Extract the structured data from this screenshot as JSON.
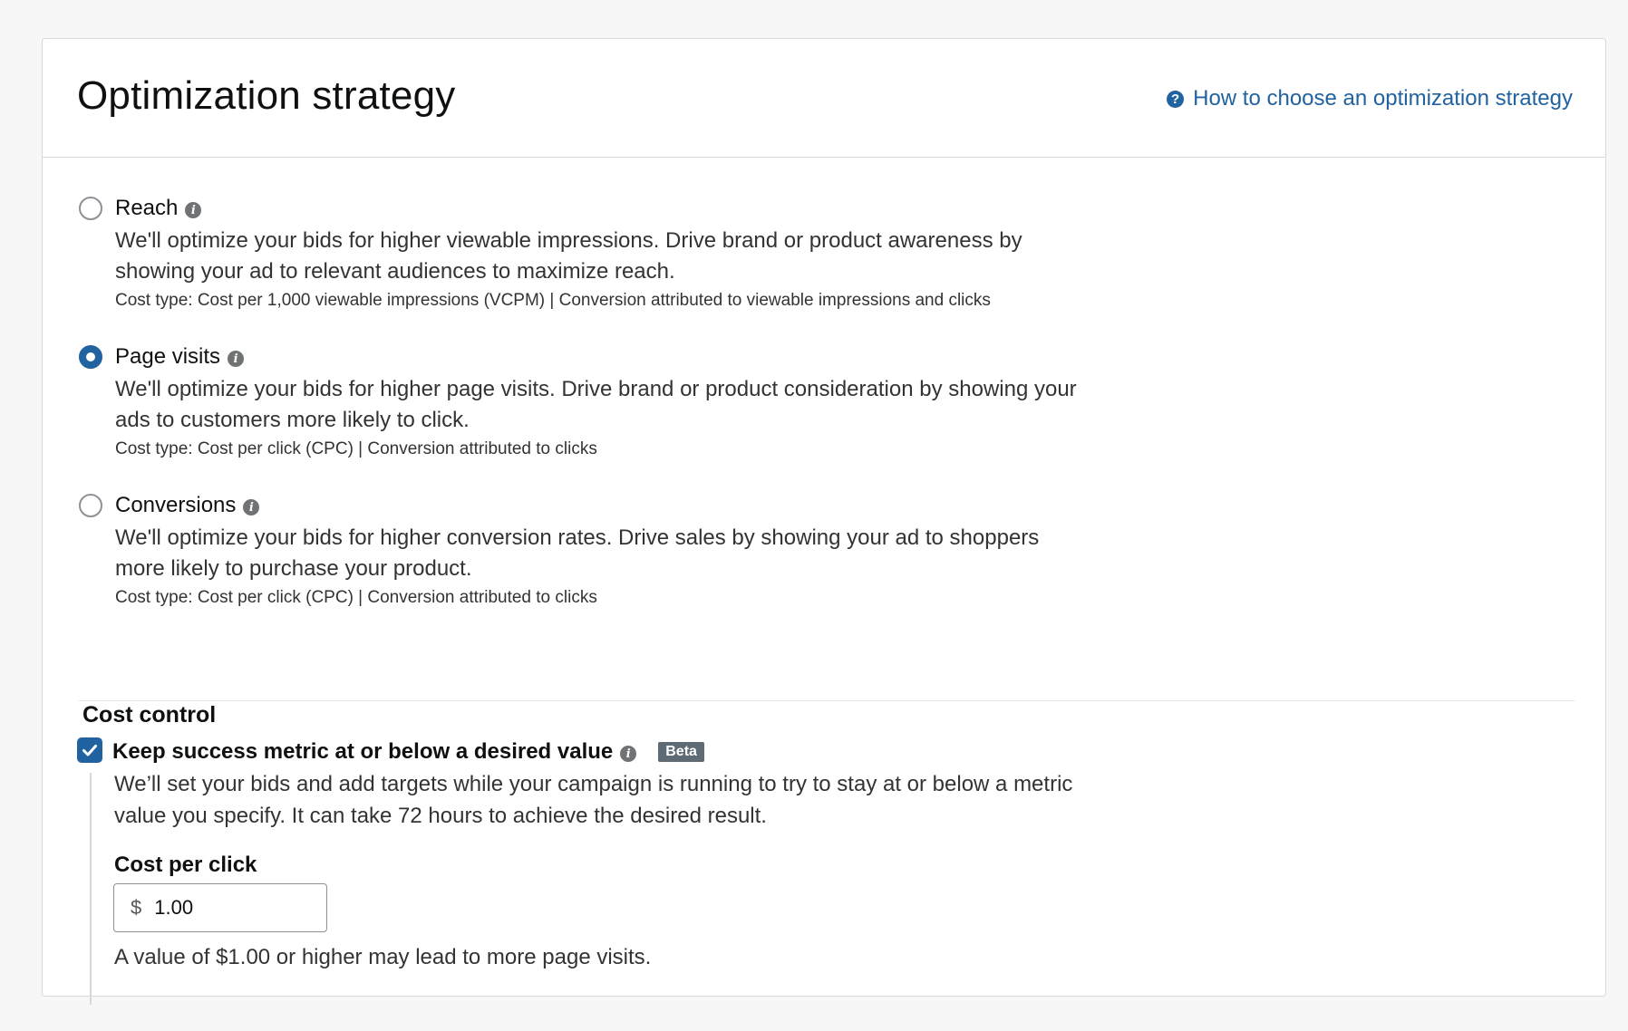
{
  "card": {
    "title": "Optimization strategy",
    "help_link": "How to choose an optimization strategy",
    "help_icon": "question-circle-icon"
  },
  "options": [
    {
      "label": "Reach",
      "checked": false,
      "description": "We'll optimize your bids for higher viewable impressions. Drive brand or product awareness by showing your ad to relevant audiences to maximize reach.",
      "cost": "Cost type: Cost per 1,000 viewable impressions (VCPM) | Conversion attributed to viewable impressions and clicks"
    },
    {
      "label": "Page visits",
      "checked": true,
      "description": "We'll optimize your bids for higher page visits. Drive brand or product consideration by showing your ads to customers more likely to click.",
      "cost": "Cost type: Cost per click (CPC) | Conversion attributed to clicks"
    },
    {
      "label": "Conversions",
      "checked": false,
      "description": "We'll optimize your bids for higher conversion rates. Drive sales by showing your ad to shoppers more likely to purchase your product.",
      "cost": "Cost type: Cost per click (CPC) | Conversion attributed to clicks"
    }
  ],
  "cost_control": {
    "title": "Cost control",
    "checkbox_label": "Keep success metric at or below a desired value",
    "checked": true,
    "badge": "Beta",
    "description": "We’ll set your bids and add targets while your campaign is running to try to stay at or below a metric value you specify. It can take 72 hours to achieve the desired result.",
    "field_label": "Cost per click",
    "currency": "$",
    "value": "1.00",
    "hint": "A value of $1.00 or higher may lead to more page visits."
  },
  "colors": {
    "accent": "#2162a1",
    "info_icon": "#6f7373",
    "beta_badge": "#5e6b75"
  }
}
